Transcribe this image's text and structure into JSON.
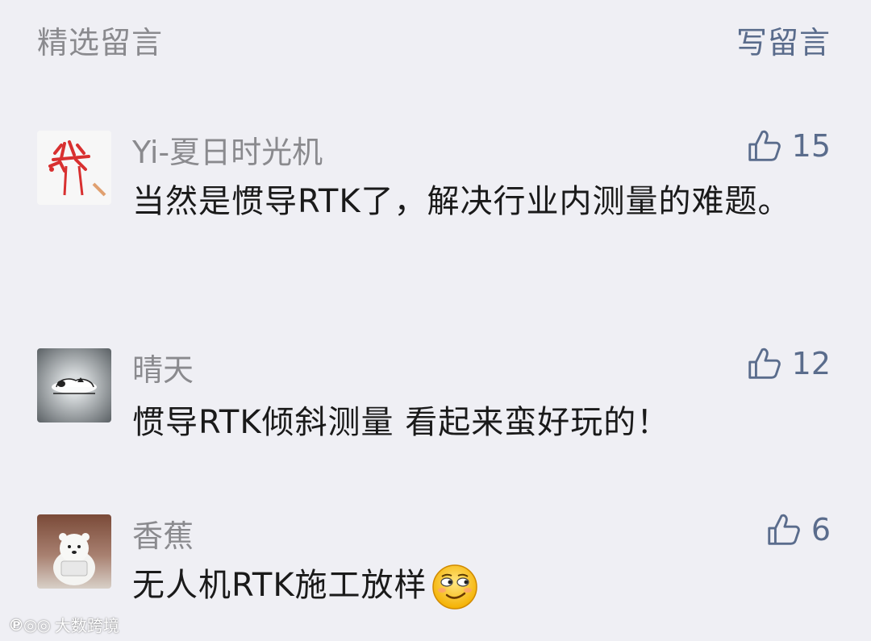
{
  "header": {
    "title": "精选留言",
    "write_label": "写留言"
  },
  "comments": [
    {
      "nickname": "Yi-夏日时光机",
      "likes": "15",
      "content": "当然是惯导RTK了，解决行业内测量的难题。",
      "avatar_icon": "red-doodle-avatar"
    },
    {
      "nickname": "晴天",
      "likes": "12",
      "content": "惯导RTK倾斜测量 看起来蛮好玩的！",
      "avatar_icon": "snoopy-sleeping-avatar"
    },
    {
      "nickname": "香蕉",
      "likes": "6",
      "content": "无人机RTK施工放样",
      "emoji": "smirk-face-emoji",
      "avatar_icon": "polar-bear-avatar"
    }
  ],
  "watermark": {
    "text": "大数跨境"
  },
  "colors": {
    "background": "#efeff4",
    "link": "#5a6c8c",
    "meta": "#8a8a8e",
    "text": "#1a1a1a"
  }
}
